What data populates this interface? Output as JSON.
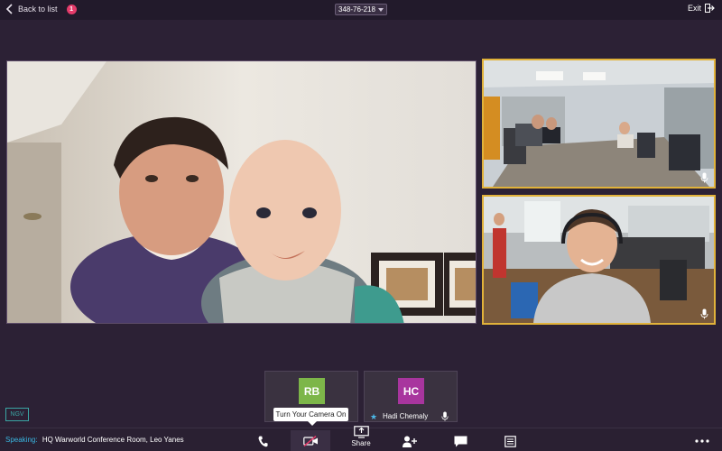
{
  "topbar": {
    "back_label": "Back to list",
    "notification_count": "1",
    "meeting_id": "348-76-218",
    "exit_label": "Exit"
  },
  "participants": [
    {
      "initials": "RB",
      "name": "",
      "color": "#7db649"
    },
    {
      "initials": "HC",
      "name": "Hadi Chemaly",
      "color": "#a8359e"
    }
  ],
  "tooltip": "Turn Your Camera On",
  "ngv_label": "NGV",
  "status": {
    "speaking_label": "Speaking:",
    "speaking_names": "HQ Warworld Conference Room, Leo Yanes"
  },
  "toolbar": {
    "share_label": "Share",
    "icons": [
      "phone-icon",
      "camera-off-icon",
      "share-screen-icon",
      "add-participant-icon",
      "chat-icon",
      "notes-icon",
      "more-icon"
    ]
  },
  "colors": {
    "background": "#2c2135",
    "active_speaker_border": "#e1b23a",
    "accent_blue": "#39b6e0",
    "badge": "#e43b6a"
  }
}
